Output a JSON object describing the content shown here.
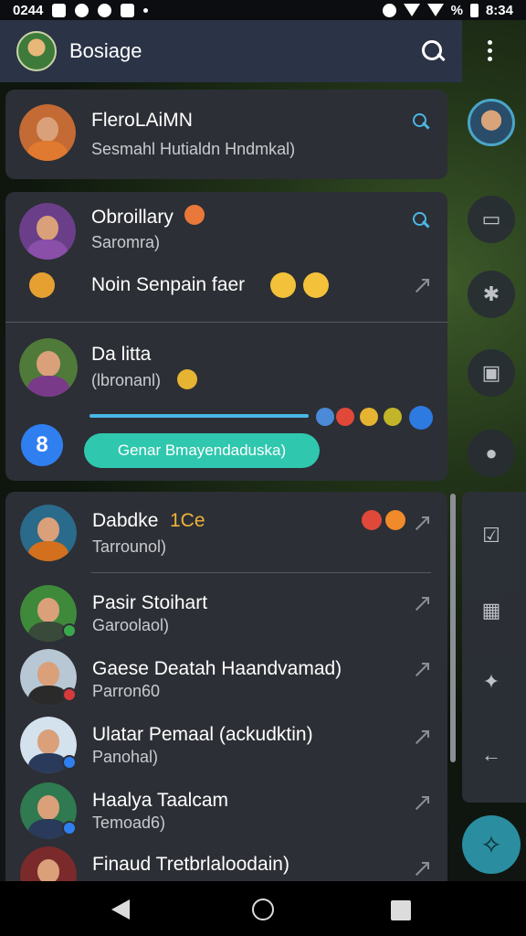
{
  "status_bar": {
    "time_left": "0244",
    "time_right": "8:34",
    "battery_percent": "%"
  },
  "app_bar": {
    "title": "Bosiage",
    "search_icon": "search-icon",
    "menu_icon": "more-vert-icon"
  },
  "cards": {
    "card1": {
      "name": "FleroLAiMN",
      "subtitle": "Sesmahl Hutialdn Hndmkal)"
    },
    "card2": {
      "name": "Obroillary",
      "subtitle": "Saromra)",
      "second_line": "Noin Senpain faer"
    },
    "card3": {
      "name": "Da litta",
      "subtitle": "(lbronanl)",
      "action_button": "Genar Bmayendaduska)"
    }
  },
  "chats": [
    {
      "name": "Dabdke",
      "name_accent": "1Ce",
      "subtitle": "Tarrounol)"
    },
    {
      "name": "Pasir Stoihart",
      "subtitle": "Garoolaol)"
    },
    {
      "name": "Gaese Deatah Haandvamad)",
      "subtitle": "Parron60"
    },
    {
      "name": "Ulatar Pemaal (ackudktin)",
      "subtitle": "Panohal)"
    },
    {
      "name": "Haalya Taalcam",
      "subtitle": "Temoad6)"
    },
    {
      "name": "Finaud Tretbrlaloodain)",
      "subtitle": ""
    }
  ],
  "colors": {
    "accent": "#4ab7e6",
    "teal_button": "#2fc7ae",
    "name_accent": "#f0b23a",
    "card_bg": "#2c2f35",
    "app_bar": "#2b3346"
  }
}
